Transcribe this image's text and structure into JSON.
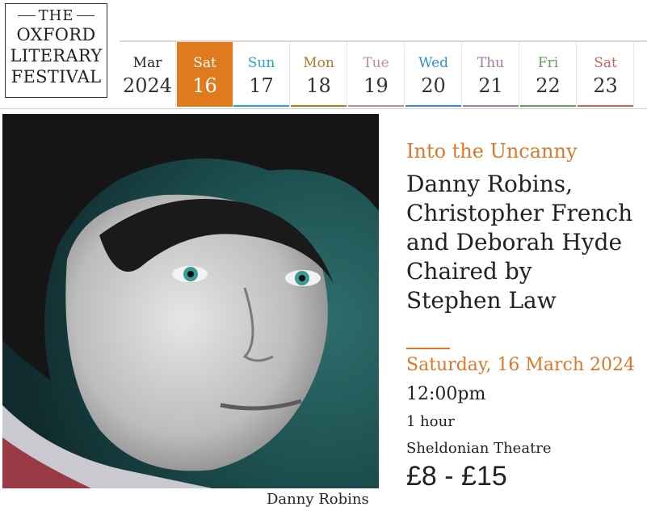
{
  "logo": {
    "line1": "THE",
    "line2": "OXFORD",
    "line3": "LITERARY",
    "line4": "FESTIVAL"
  },
  "calendar": {
    "month": "Mar",
    "year": "2024",
    "days": [
      {
        "name": "Sat",
        "num": "16",
        "active": true,
        "color": "#e07a1f"
      },
      {
        "name": "Sun",
        "num": "17",
        "color": "#2aa6c9"
      },
      {
        "name": "Mon",
        "num": "18",
        "color": "#b07a22"
      },
      {
        "name": "Tue",
        "num": "19",
        "color": "#c58a9a"
      },
      {
        "name": "Wed",
        "num": "20",
        "color": "#2f8fd0"
      },
      {
        "name": "Thu",
        "num": "21",
        "color": "#a47aa0"
      },
      {
        "name": "Fri",
        "num": "22",
        "color": "#5aa05a"
      },
      {
        "name": "Sat",
        "num": "23",
        "color": "#c86262"
      }
    ]
  },
  "event": {
    "series": "Into the Uncanny",
    "title_lines": [
      "Danny Robins,",
      "Christopher French",
      "and Deborah Hyde",
      "Chaired by",
      "Stephen Law"
    ],
    "date": "Saturday, 16 March 2024",
    "time": "12:00pm",
    "duration": "1 hour",
    "venue": "Sheldonian Theatre",
    "price": "£8 - £15",
    "photo_caption": "Danny Robins"
  }
}
